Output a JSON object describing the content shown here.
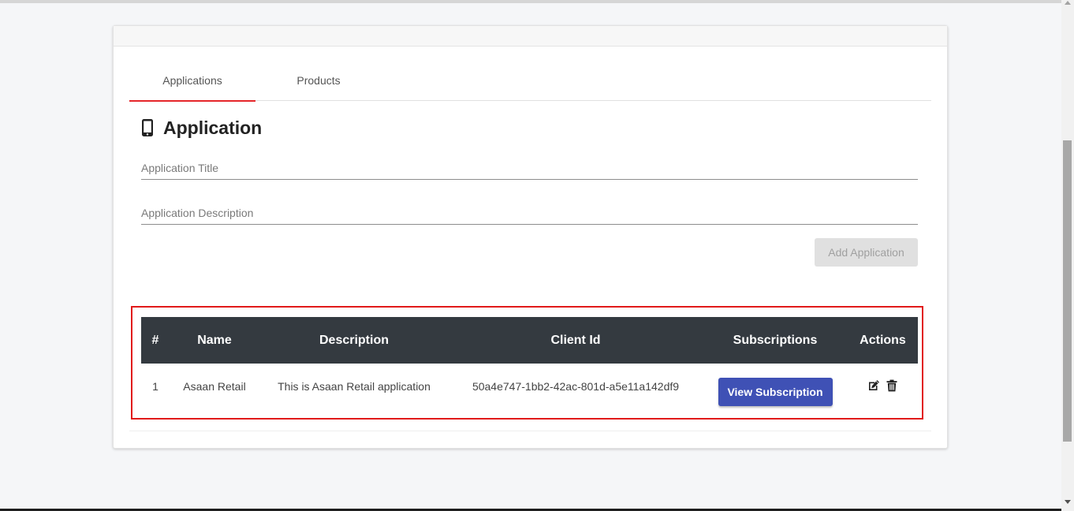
{
  "tabs": [
    {
      "label": "Applications",
      "active": true
    },
    {
      "label": "Products",
      "active": false
    }
  ],
  "section": {
    "title": "Application",
    "icon": "mobile-phone-icon"
  },
  "form": {
    "title_placeholder": "Application Title",
    "title_value": "",
    "description_placeholder": "Application Description",
    "description_value": "",
    "add_button_label": "Add Application"
  },
  "table": {
    "headers": {
      "index": "#",
      "name": "Name",
      "description": "Description",
      "client_id": "Client Id",
      "subscriptions": "Subscriptions",
      "actions": "Actions"
    },
    "rows": [
      {
        "index": "1",
        "name": "Asaan Retail",
        "description": "This is Asaan Retail application",
        "client_id": "50a4e747-1bb2-42ac-801d-a5e11a142df9",
        "subscription_button": "View Subscription",
        "actions": [
          "edit-icon",
          "trash-icon"
        ]
      }
    ]
  },
  "colors": {
    "tab_indicator": "#e5262a",
    "highlight_border": "#e11a1a",
    "table_header_bg": "#343a40",
    "primary_button": "#3f51b5"
  }
}
